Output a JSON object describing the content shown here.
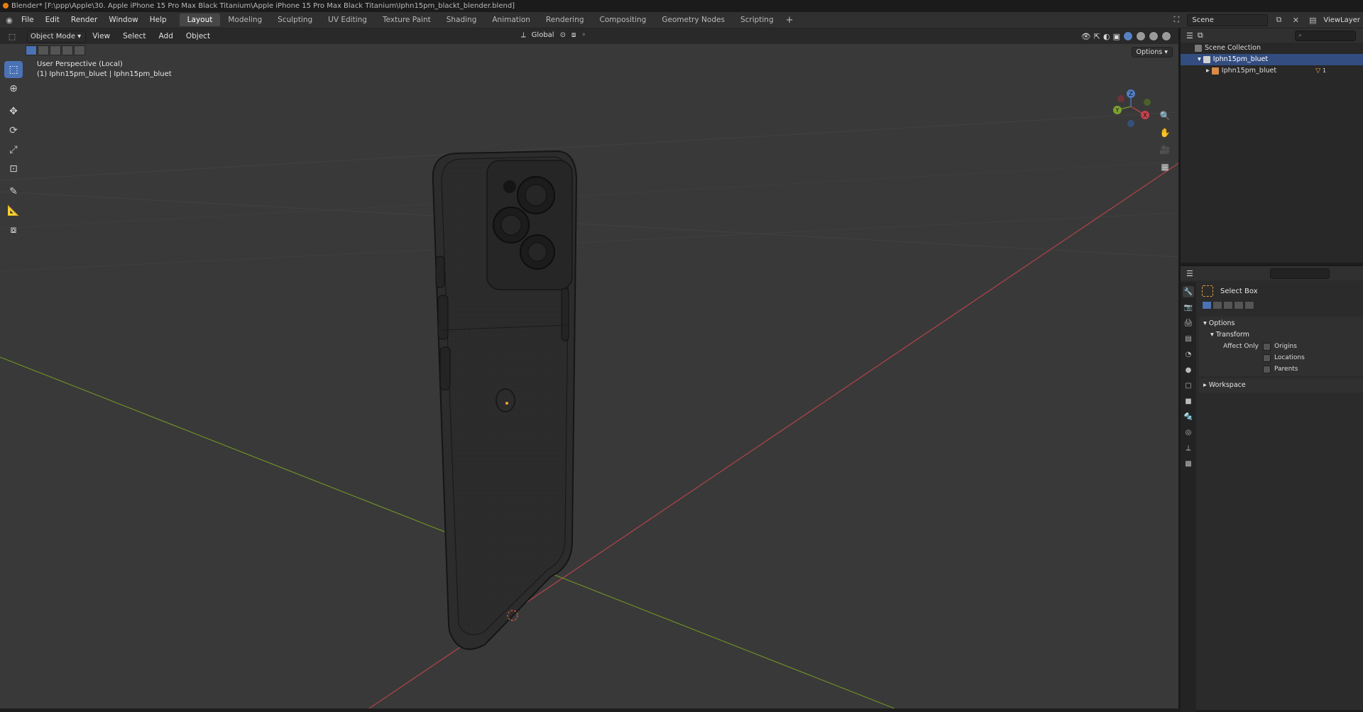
{
  "window": {
    "title": "Blender* [F:\\ppp\\Apple\\30. Apple iPhone 15 Pro Max Black Titanium\\Apple iPhone 15 Pro Max Black Titanium\\Iphn15pm_blackt_blender.blend]"
  },
  "topbar": {
    "menus": [
      "File",
      "Edit",
      "Render",
      "Window",
      "Help"
    ],
    "workspaces": [
      "Layout",
      "Modeling",
      "Sculpting",
      "UV Editing",
      "Texture Paint",
      "Shading",
      "Animation",
      "Rendering",
      "Compositing",
      "Geometry Nodes",
      "Scripting"
    ],
    "active_workspace": "Layout",
    "add_workspace": "+",
    "scene": "Scene",
    "view_layer": "ViewLayer"
  },
  "viewport": {
    "mode": "Object Mode",
    "menus": [
      "View",
      "Select",
      "Add",
      "Object"
    ],
    "orientation": "Global",
    "options_label": "Options",
    "overlay_title": "User Perspective (Local)",
    "overlay_object": "(1) Iphn15pm_bluet | Iphn15pm_bluet",
    "gizmo_axes": [
      "X",
      "Y",
      "Z"
    ],
    "accent": "#4a72b5"
  },
  "outliner": {
    "root": "Scene Collection",
    "collection": "Iphn15pm_bluet",
    "object": "Iphn15pm_bluet",
    "object_badge": "1"
  },
  "properties": {
    "tool_name": "Select Box",
    "options_panel": "Options",
    "transform_panel": "Transform",
    "affect_only_label": "Affect Only",
    "checkboxes": [
      "Origins",
      "Locations",
      "Parents"
    ],
    "workspace_panel": "Workspace"
  }
}
